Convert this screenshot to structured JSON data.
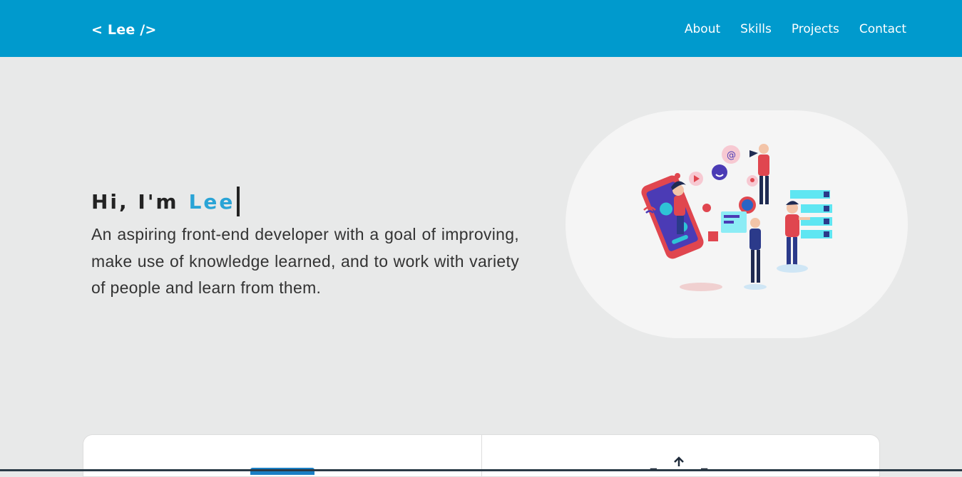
{
  "nav": {
    "logo": "< Lee />",
    "links": [
      "About",
      "Skills",
      "Projects",
      "Contact"
    ]
  },
  "hero": {
    "greeting": "Hi, I'm",
    "name": "Lee",
    "description": "An aspiring front-end developer with a goal of improving, make use of knowledge learned, and to work with variety of people and learn from them.",
    "illustration": "social-media-people-icon"
  },
  "colors": {
    "navbar": "#009acd",
    "accent": "#2aa4d6",
    "background": "#e8e9e9"
  },
  "cards": {
    "icons": [
      "laptop-icon",
      "upload-icon"
    ]
  }
}
